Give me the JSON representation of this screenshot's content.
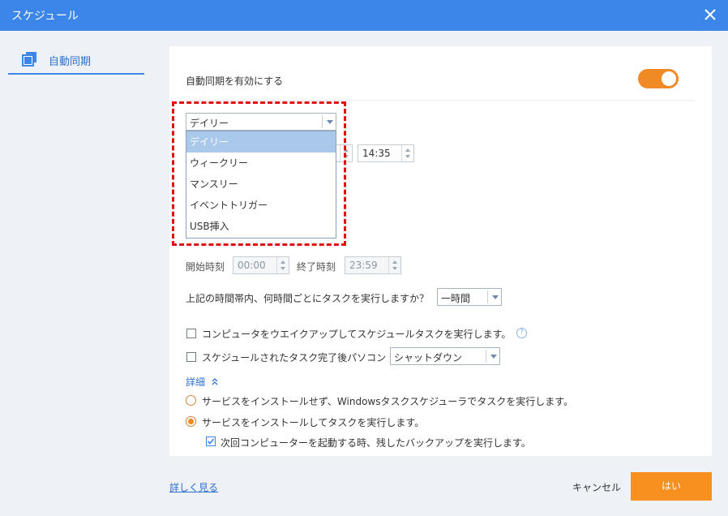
{
  "window": {
    "title": "スケジュール"
  },
  "sidebar": {
    "items": [
      {
        "label": "自動同期"
      }
    ]
  },
  "main": {
    "enable_label": "自動同期を有効にする",
    "enable_on": true,
    "frequency": {
      "selected": "デイリー",
      "options": [
        "デイリー",
        "ウィークリー",
        "マンスリー",
        "イベントトリガー",
        "USB挿入"
      ]
    },
    "time": "14:35",
    "start_label": "開始時刻",
    "start_value": "00:00",
    "end_label": "終了時刻",
    "end_value": "23:59",
    "interval_label": "上記の時間帯内、何時間ごとにタスクを実行しますか？",
    "interval_value": "一時間",
    "wake_label": "コンピュータをウエイクアップしてスケジュールタスクを実行します。",
    "wake_help": "?",
    "after_label": "スケジュールされたタスク完了後パソコン",
    "after_value": "シャットダウン",
    "details_label": "詳細",
    "radio1_label": "サービスをインストールせず、Windowsタスクスケジューラでタスクを実行します。",
    "radio2_label": "サービスをインストールしてタスクを実行します。",
    "sub_check_label": "次回コンピューターを起動する時、残したバックアップを実行します。"
  },
  "footer": {
    "learn_more": "詳しく見る",
    "cancel": "キャンセル",
    "ok": "はい"
  },
  "colors": {
    "accent": "#f7901e",
    "titlebar": "#3b86e8",
    "highlight": "#e01010"
  }
}
